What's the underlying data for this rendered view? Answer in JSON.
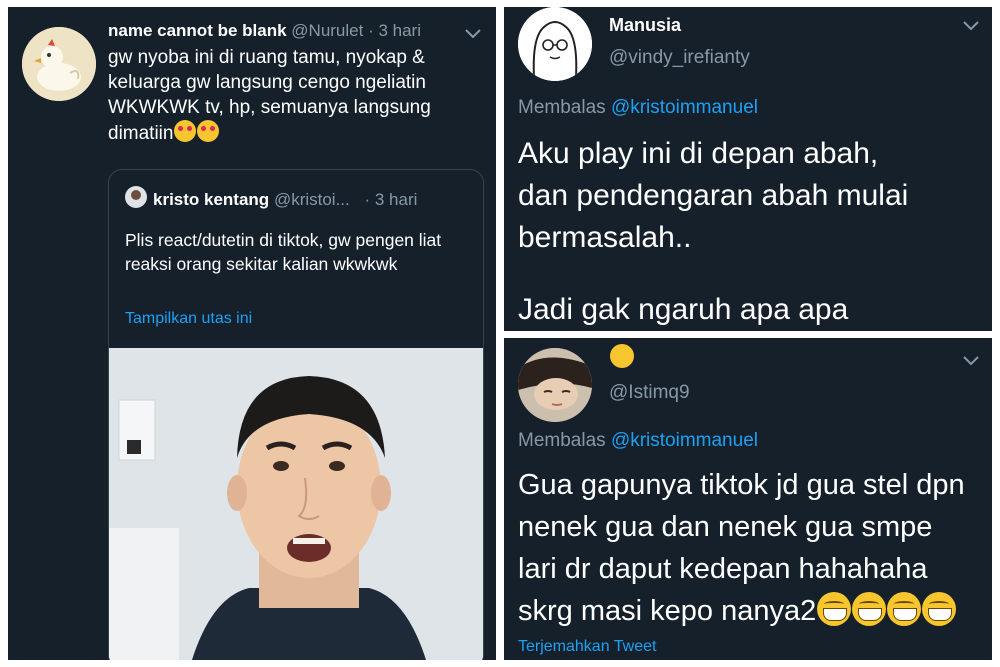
{
  "left_tweet": {
    "display_name": "name cannot be blank",
    "handle": "@Nurulet",
    "time": "· 3 hari",
    "text": "gw nyoba ini di ruang tamu, nyokap & keluarga gw langsung cengo ngeliatin WKWKWK tv, hp, semuanya langsung dimatiin",
    "emoji_icons": [
      "smiling-face-with-hearts-icon",
      "smiling-face-with-hearts-icon"
    ],
    "quoted": {
      "display_name": "kristo kentang",
      "handle": "@kristoi...",
      "time": "· 3 hari",
      "text": "Plis react/dutetin di tiktok, gw pengen liat reaksi orang sekitar kalian wkwkwk",
      "show_thread": "Tampilkan utas ini"
    }
  },
  "top_right_tweet": {
    "display_name": "Manusia",
    "handle": "@vindy_irefianty",
    "reply_prefix": "Membalas",
    "reply_to": "@kristoimmanuel",
    "text_lines": [
      "Aku play ini di depan abah,",
      "dan pendengaran abah mulai",
      "bermasalah..",
      "",
      "Jadi gak ngaruh apa apa"
    ]
  },
  "bottom_right_tweet": {
    "display_name_emoji": "smiling-face-icon",
    "handle": "@Istimq9",
    "reply_prefix": "Membalas",
    "reply_to": "@kristoimmanuel",
    "text_lines": [
      "Gua gapunya tiktok jd gua stel dpn",
      "nenek gua dan nenek gua smpe",
      "lari dr daput kedepan hahahaha",
      "skrg masi kepo nanya2"
    ],
    "emoji_icons": [
      "grinning-squinting-face-icon",
      "grinning-squinting-face-icon",
      "grinning-squinting-face-icon",
      "grinning-squinting-face-icon"
    ],
    "translate": "Terjemahkan Tweet"
  },
  "colors": {
    "background": "#15202b",
    "text": "#ffffff",
    "muted": "#8899a6",
    "link": "#1da1f2",
    "border": "#38444d"
  }
}
